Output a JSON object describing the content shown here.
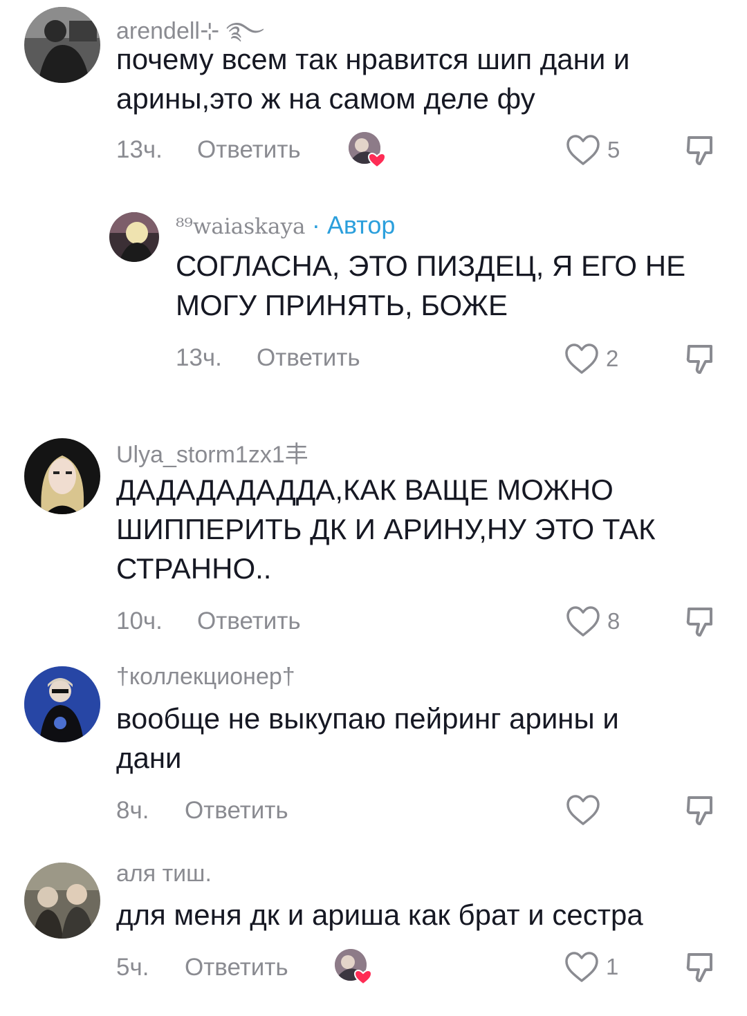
{
  "comments": [
    {
      "username": "arendell⊹ ࿐",
      "text_lines": [
        "почему всем так нравится шип дани и",
        "арины,это ж на самом деле фу"
      ],
      "time": "13ч.",
      "reply_label": "Ответить",
      "likes": "5",
      "creator_liked": true
    },
    {
      "username": "⁸⁹waiaskaya",
      "author_badge": "· Автор",
      "text_lines": [
        "СОГЛАСНА, ЭТО ПИЗДЕЦ, Я ЕГО НЕ",
        "МОГУ ПРИНЯТЬ, БОЖЕ"
      ],
      "time": "13ч.",
      "reply_label": "Ответить",
      "likes": "2"
    },
    {
      "username": "Ulya_storm1zx1丰",
      "text_lines": [
        "ДАДАДАДАДДА,КАК ВАЩЕ МОЖНО",
        "ШИППЕРИТЬ ДК И АРИНУ,НУ ЭТО ТАК",
        "СТРАННО.."
      ],
      "time": "10ч.",
      "reply_label": "Ответить",
      "likes": "8"
    },
    {
      "username": "†коллекционер†",
      "text_lines": [
        "вообще не выкупаю пейринг арины и",
        "дани"
      ],
      "time": "8ч.",
      "reply_label": "Ответить",
      "likes": ""
    },
    {
      "username": "аля тиш.",
      "text_lines": [
        "для меня дк и ариша как брат и сестра"
      ],
      "time": "5ч.",
      "reply_label": "Ответить",
      "likes": "1",
      "creator_liked": true
    }
  ],
  "colors": {
    "text": "#161823",
    "muted": "#8a8b91",
    "author_badge": "#2b9fdc",
    "creator_heart": "#fe2c55"
  },
  "icons": [
    "heart-outline-icon",
    "dislike-icon",
    "creator-liked-heart-icon"
  ]
}
